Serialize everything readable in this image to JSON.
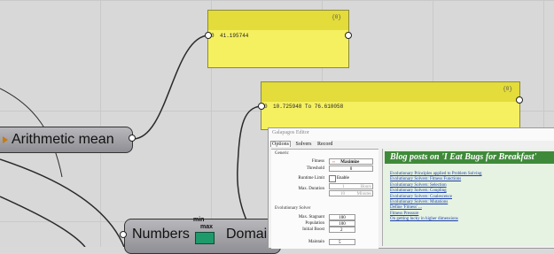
{
  "panel_top": {
    "index": "{0}",
    "row_index": "0",
    "value": "41.195744"
  },
  "panel_bottom": {
    "index": "{0}",
    "row_index": "0",
    "value": "10.725948 To 76.610058"
  },
  "components": {
    "arithmetic_mean": "Arithmetic mean",
    "numbers": "Numbers",
    "domain": "Domain",
    "icon_min": "min",
    "icon_max": "max"
  },
  "galapagos": {
    "title": "Galapagos Editor",
    "tabs": [
      "Options",
      "Solvers",
      "Record"
    ],
    "generic_label": "Generic",
    "fitness_label": "Fitness",
    "fitness_value": "Maximize",
    "threshold_label": "Threshold",
    "threshold_value": "0",
    "runtime_label": "Runtime Limit",
    "runtime_enable": "Enable",
    "max_duration_label": "Max. Duration",
    "hours_value": "1",
    "hours_unit": "Hours",
    "minutes_value": "10",
    "minutes_unit": "Minutes",
    "evo_label": "Evolutionary Solver",
    "max_stagnant_label": "Max. Stagnant",
    "max_stagnant_value": "100",
    "population_label": "Population",
    "population_value": "100",
    "initial_boost_label": "Initial Boost",
    "initial_boost_value": "2",
    "maintain_label": "Maintain",
    "maintain_value": "5",
    "blog_heading": "Blog posts on 'I Eat Bugs for Breakfast'",
    "blog_links": [
      "Evolutionary Principles applied to Problem Solving",
      "Evolutionary Solvers: Fitness Functions",
      "Evolutionary Solvers: Selection",
      "Evolutionary Solvers: Coupling",
      "Evolutionary Solvers: Coalescence",
      "Evolutionary Solvers: Mutations",
      "Define 'Fitness' ...",
      "Fitness Pressure",
      "On getting lucky in higher dimensions"
    ]
  },
  "colors": {
    "panel": "#f5f060",
    "panel_band": "#e3dc3a",
    "component": "#a3a3a8",
    "blog_header": "#3f8a3a"
  }
}
